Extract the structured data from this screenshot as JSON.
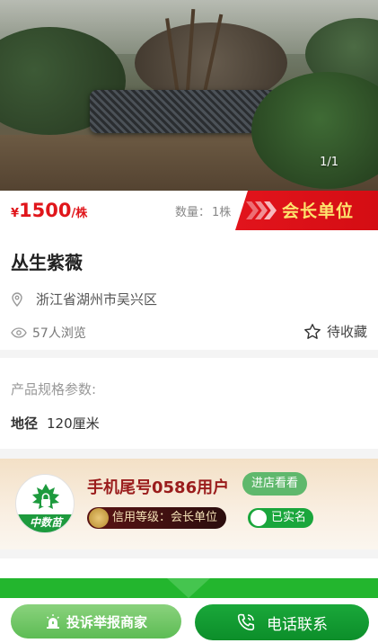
{
  "gallery": {
    "counter": "1/1"
  },
  "pricing": {
    "currency": "¥",
    "price": "1500",
    "unit": "/株",
    "qty_label": "数量：",
    "qty_value": "1株",
    "member_badge": "会长单位"
  },
  "product": {
    "title": "丛生紫薇",
    "location": "浙江省湖州市吴兴区",
    "views": "57人浏览",
    "favorite_label": "待收藏"
  },
  "specs": {
    "heading": "产品规格参数:",
    "rows": [
      {
        "key": "地径",
        "value": "120厘米"
      }
    ]
  },
  "seller": {
    "logo_text": "中数苗",
    "name": "手机尾号0586用户",
    "visit_label": "进店看看",
    "credit_label": "信用等级：会长单位",
    "verified_label": "已实名"
  },
  "actions": {
    "report_label": "投诉举报商家",
    "call_label": "电话联系"
  },
  "colors": {
    "price_red": "#e0161b",
    "badge_red": "#e2141c",
    "badge_text": "#fde36d",
    "primary_green": "#1aa83a"
  }
}
